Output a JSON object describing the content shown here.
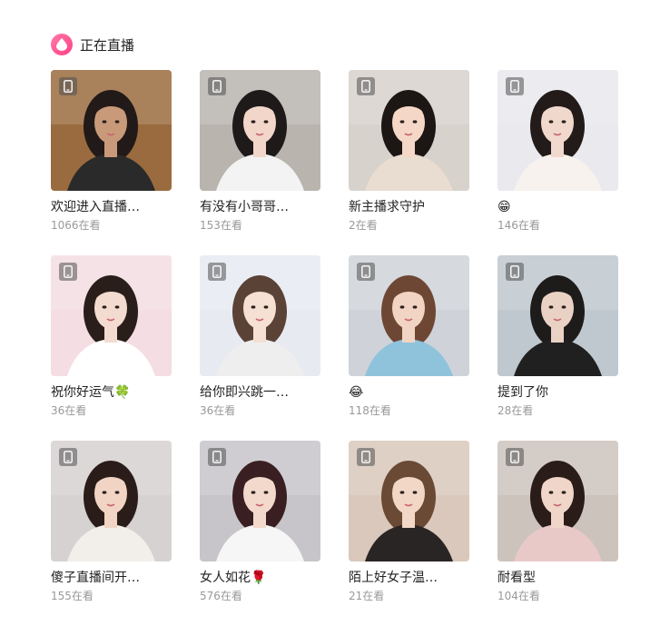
{
  "section": {
    "title": "正在直播",
    "icon": "live-drop-icon",
    "accent": "#ff4d8d"
  },
  "rooms": [
    {
      "title": "欢迎进入直播…",
      "viewers": "1066",
      "viewers_suffix": "在看",
      "bg": "#9a6b3f",
      "skin": "#c89a7a",
      "hair": "#221a18",
      "cloth": "#2a2a2a"
    },
    {
      "title": "有没有小哥哥…",
      "viewers": "153",
      "viewers_suffix": "在看",
      "bg": "#b9b4ae",
      "skin": "#f2d6c9",
      "hair": "#1f1a1a",
      "cloth": "#f3f3f3"
    },
    {
      "title": "新主播求守护",
      "viewers": "2",
      "viewers_suffix": "在看",
      "bg": "#d7d2cc",
      "skin": "#f4d7c6",
      "hair": "#1c1614",
      "cloth": "#e9dcd1"
    },
    {
      "title": "😁",
      "viewers": "146",
      "viewers_suffix": "在看",
      "bg": "#e9e9ee",
      "skin": "#f1d8cc",
      "hair": "#231b19",
      "cloth": "#f7f2ee"
    },
    {
      "title": "祝你好运气🍀",
      "viewers": "36",
      "viewers_suffix": "在看",
      "bg": "#f4dde3",
      "skin": "#f4dbd0",
      "hair": "#2a1e1a",
      "cloth": "#ffffff"
    },
    {
      "title": "给你即兴跳一…",
      "viewers": "36",
      "viewers_suffix": "在看",
      "bg": "#e8eaf2",
      "skin": "#f6dfd3",
      "hair": "#5b4236",
      "cloth": "#eeeeee"
    },
    {
      "title": "😂",
      "viewers": "118",
      "viewers_suffix": "在看",
      "bg": "#cfd3d9",
      "skin": "#f1d4c3",
      "hair": "#6e4734",
      "cloth": "#8fc3dc"
    },
    {
      "title": "提到了你",
      "viewers": "28",
      "viewers_suffix": "在看",
      "bg": "#bfc8cf",
      "skin": "#e9d2c4",
      "hair": "#1e1b1b",
      "cloth": "#202020"
    },
    {
      "title": "傻子直播间开…",
      "viewers": "155",
      "viewers_suffix": "在看",
      "bg": "#d6d2d2",
      "skin": "#f2d4c4",
      "hair": "#2a1d19",
      "cloth": "#f2efea"
    },
    {
      "title": "女人如花🌹",
      "viewers": "576",
      "viewers_suffix": "在看",
      "bg": "#c7c5c9",
      "skin": "#f3d8cc",
      "hair": "#3a1f22",
      "cloth": "#f6f6f6"
    },
    {
      "title": "陌上好女子温…",
      "viewers": "21",
      "viewers_suffix": "在看",
      "bg": "#d9c8bb",
      "skin": "#f2d7c6",
      "hair": "#6a4a34",
      "cloth": "#2a2525"
    },
    {
      "title": "耐看型",
      "viewers": "104",
      "viewers_suffix": "在看",
      "bg": "#cdc3bd",
      "skin": "#f0d6c8",
      "hair": "#2a1c18",
      "cloth": "#e9c9c8"
    }
  ]
}
